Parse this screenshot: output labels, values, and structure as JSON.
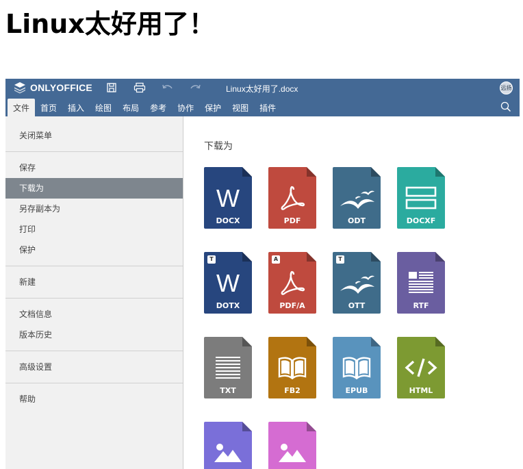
{
  "page": {
    "heading": "Linux太好用了！"
  },
  "app": {
    "brand": "ONLYOFFICE",
    "document_title": "Linux太好用了.docx",
    "avatar_initials": "远扬",
    "colors": {
      "header": "#446995",
      "sidebar": "#f1f1f1",
      "sidebar_active": "#7e868e"
    }
  },
  "toolbar_icons": [
    "save-icon",
    "print-icon",
    "undo-icon",
    "redo-icon"
  ],
  "tabs": [
    "文件",
    "首页",
    "插入",
    "绘图",
    "布局",
    "参考",
    "协作",
    "保护",
    "视图",
    "插件"
  ],
  "sidebar": {
    "close_menu": "关闭菜单",
    "save": "保存",
    "download_as": "下载为",
    "save_copy_as": "另存副本为",
    "print": "打印",
    "protect": "保护",
    "new": "新建",
    "doc_info": "文档信息",
    "version_history": "版本历史",
    "advanced_settings": "高级设置",
    "help": "帮助"
  },
  "panel": {
    "title": "下载为"
  },
  "formats": [
    {
      "label": "DOCX",
      "color": "#27467e",
      "glyph": "W",
      "badge": ""
    },
    {
      "label": "PDF",
      "color": "#bf4a3e",
      "glyph": "pdf",
      "badge": ""
    },
    {
      "label": "ODT",
      "color": "#3f6c8a",
      "glyph": "gulls",
      "badge": ""
    },
    {
      "label": "DOCXF",
      "color": "#2bab9f",
      "glyph": "form",
      "badge": ""
    },
    {
      "label": "DOTX",
      "color": "#27467e",
      "glyph": "W",
      "badge": "T"
    },
    {
      "label": "PDF/A",
      "color": "#bf4a3e",
      "glyph": "pdf",
      "badge": "A"
    },
    {
      "label": "OTT",
      "color": "#3f6c8a",
      "glyph": "gulls",
      "badge": "T"
    },
    {
      "label": "RTF",
      "color": "#6a5ea0",
      "glyph": "rtf",
      "badge": ""
    },
    {
      "label": "TXT",
      "color": "#7c7c7c",
      "glyph": "txt",
      "badge": ""
    },
    {
      "label": "FB2",
      "color": "#b27411",
      "glyph": "book",
      "badge": ""
    },
    {
      "label": "EPUB",
      "color": "#5993bd",
      "glyph": "book",
      "badge": ""
    },
    {
      "label": "HTML",
      "color": "#7d9a32",
      "glyph": "code",
      "badge": ""
    },
    {
      "label": "",
      "color": "#7a6fd9",
      "glyph": "image",
      "badge": ""
    },
    {
      "label": "",
      "color": "#d56cd2",
      "glyph": "image",
      "badge": ""
    }
  ]
}
